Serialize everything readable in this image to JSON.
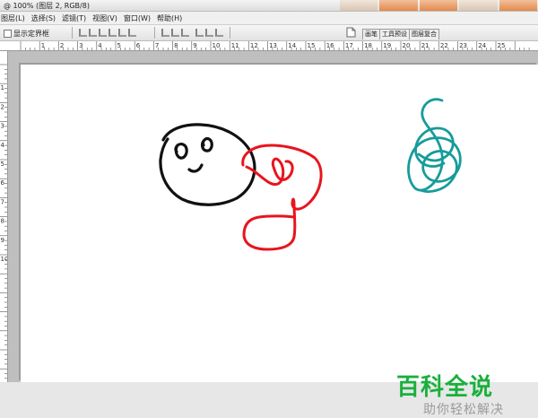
{
  "window": {
    "title": "@ 100% (图层 2, RGB/8)",
    "zoom": "100%",
    "layer": "图层 2",
    "mode": "RGB/8"
  },
  "menu": {
    "items": [
      "图层(L)",
      "选择(S)",
      "滤镜(T)",
      "视图(V)",
      "窗口(W)",
      "帮助(H)"
    ]
  },
  "options": {
    "show_bounds_label": "显示定界框",
    "show_bounds_checked": false
  },
  "palette_tabs": [
    "画笔",
    "工具预设",
    "图层复合"
  ],
  "ruler": {
    "top_labels": [
      "1",
      "2",
      "3",
      "4",
      "5",
      "6",
      "7",
      "8",
      "9",
      "10",
      "11",
      "12",
      "13",
      "14",
      "15",
      "16",
      "17",
      "18",
      "19",
      "20",
      "21",
      "22",
      "23",
      "24",
      "25"
    ],
    "left_labels": [
      "1",
      "2",
      "3",
      "4",
      "5",
      "6",
      "7",
      "8",
      "9",
      "10"
    ]
  },
  "watermark": {
    "title": "百科全说",
    "subtitle": "助你轻松解决",
    "title_color": "#19b03c",
    "subtitle_color": "#9a9a9a"
  },
  "strokes": {
    "face_color": "#111111",
    "red_color": "#e8141e",
    "teal_color": "#169c9a"
  },
  "icons": [
    "document-icon",
    "align-icon",
    "distribute-icon"
  ]
}
